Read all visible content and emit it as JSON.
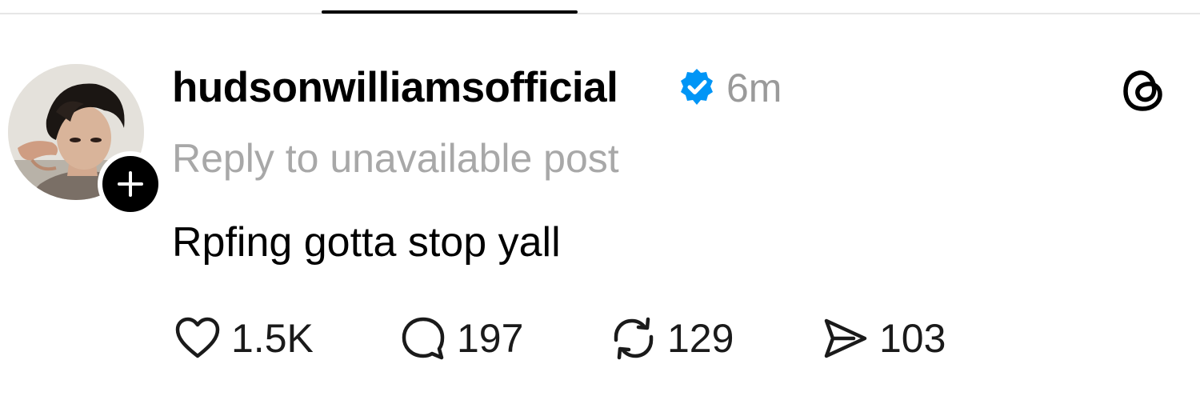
{
  "tabs": {
    "active_indicator": "active-tab"
  },
  "author": {
    "username": "hudsonwilliamsofficial",
    "verified": true,
    "timestamp": "6m"
  },
  "post": {
    "reply_context": "Reply to unavailable post",
    "text": "Rpfing gotta stop yall"
  },
  "actions": {
    "likes": "1.5K",
    "replies": "197",
    "reposts": "129",
    "shares": "103"
  },
  "icons": {
    "like": "heart-icon",
    "reply": "comment-icon",
    "repost": "repost-icon",
    "share": "send-icon",
    "brand": "threads-logo-icon",
    "verified": "verified-badge-icon",
    "follow": "plus-icon"
  },
  "colors": {
    "verified_blue": "#0095f6",
    "muted_text": "#9a9a9a",
    "text": "#000000"
  }
}
